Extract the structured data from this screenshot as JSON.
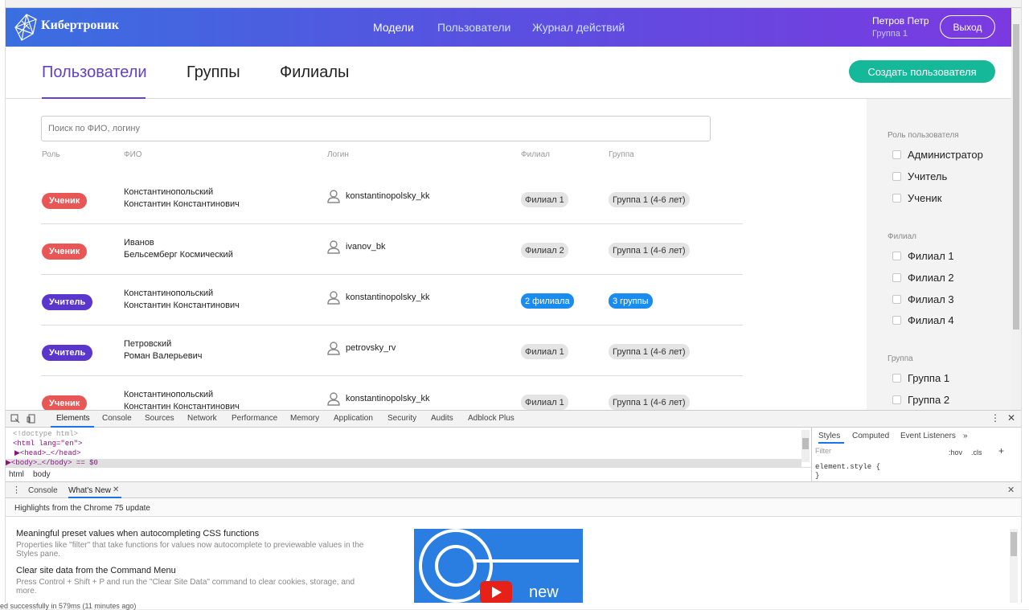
{
  "app": {
    "brand": "Кибертроник",
    "nav": [
      "Модели",
      "Пользователи",
      "Журнал действий"
    ],
    "user_name": "Петров Петр",
    "user_group": "Группа 1",
    "logout_label": "Выход"
  },
  "tabs": [
    "Пользователи",
    "Группы",
    "Филиалы"
  ],
  "create_button": "Создать пользователя",
  "search_placeholder": "Поиск по ФИО, логину",
  "columns": [
    "Роль",
    "ФИО",
    "Логин",
    "Филиал",
    "Группа"
  ],
  "rows": [
    {
      "role": "Ученик",
      "fio1": "Константинопольский",
      "fio2": "Константин Константинович",
      "login": "konstantinopolsky_kk",
      "branch": "Филиал 1",
      "group": "Группа 1 (4-6 лет)"
    },
    {
      "role": "Ученик",
      "fio1": "Иванов",
      "fio2": "Бельсемберг Космический",
      "login": "ivanov_bk",
      "branch": "Филиал 2",
      "group": "Группа 1 (4-6 лет)"
    },
    {
      "role": "Учитель",
      "fio1": "Константинопольский",
      "fio2": "Константин Константинович",
      "login": "konstantinopolsky_kk",
      "branch": "2 филиала",
      "group": "3 группы"
    },
    {
      "role": "Учитель",
      "fio1": "Петровский",
      "fio2": "Роман Валерьевич",
      "login": "petrovsky_rv",
      "branch": "Филиал 1",
      "group": "Группа 1 (4-6 лет)"
    },
    {
      "role": "Ученик",
      "fio1": "Константинопольский",
      "fio2": "Константин Константинович",
      "login": "konstantinopolsky_kk",
      "branch": "Филиал 1",
      "group": "Группа 1 (4-6 лет)"
    }
  ],
  "filters": {
    "role_title": "Роль пользователя",
    "roles": [
      "Администратор",
      "Учитель",
      "Ученик"
    ],
    "branch_title": "Филиал",
    "branches": [
      "Филиал 1",
      "Филиал 2",
      "Филиал 3",
      "Филиал 4"
    ],
    "group_title": "Группа",
    "groups": [
      "Группа 1",
      "Группа 2"
    ]
  },
  "devtools": {
    "tabs": [
      "Elements",
      "Console",
      "Sources",
      "Network",
      "Performance",
      "Memory",
      "Application",
      "Security",
      "Audits",
      "Adblock Plus"
    ],
    "code": [
      "<!doctype html>",
      "<html lang=\"en\">",
      "▶<head>…</head>",
      "▶<body>…</body> == $0"
    ],
    "breadcrumb": [
      "html",
      "body"
    ],
    "styles_tabs": [
      "Styles",
      "Computed",
      "Event Listeners",
      "»"
    ],
    "filter_placeholder": "Filter",
    "hov": ":hov",
    "cls": ".cls",
    "element_style": "element.style {",
    "element_style_close": "}",
    "drawer_tabs": [
      "Console",
      "What's New"
    ],
    "highlights": "Highlights from the Chrome 75 update",
    "items": [
      {
        "title": "Meaningful preset values when autocompleting CSS functions",
        "desc1": "Properties like \"filter\" that take functions for values now autocomplete to previewable values in the",
        "desc2": "Styles pane."
      },
      {
        "title": "Clear site data from the Command Menu",
        "desc1": "Press Control + Shift + P and run the \"Clear Site Data\" command to clear cookies, storage, and",
        "desc2": "more."
      }
    ],
    "video_label": "new"
  },
  "status_text": "ed successfully in 579ms (11 minutes ago)"
}
